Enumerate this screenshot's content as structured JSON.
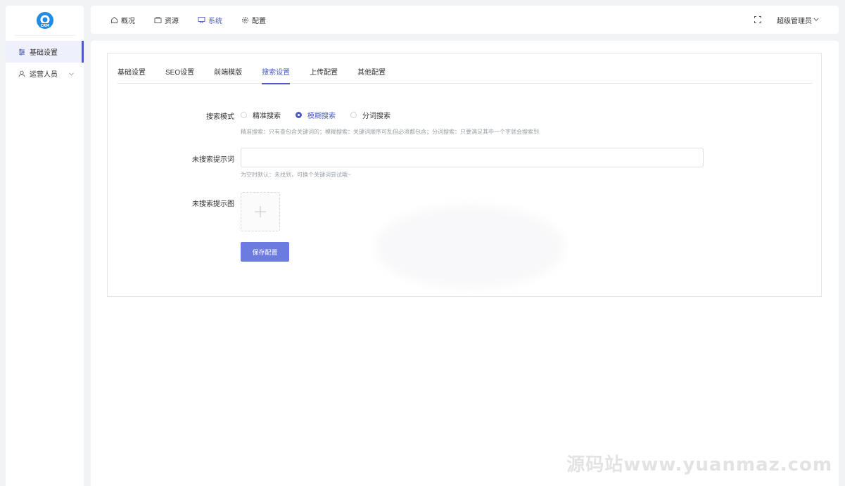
{
  "logo": {
    "text": "CRM"
  },
  "sidebar": {
    "items": [
      {
        "label": "基础设置",
        "icon": "sliders-icon"
      },
      {
        "label": "运营人员",
        "icon": "user-icon"
      }
    ]
  },
  "topnav": {
    "items": [
      {
        "label": "概况",
        "icon": "home-icon"
      },
      {
        "label": "资源",
        "icon": "folder-icon"
      },
      {
        "label": "系统",
        "icon": "monitor-icon"
      },
      {
        "label": "配置",
        "icon": "gear-icon"
      }
    ],
    "user": "超级管理员"
  },
  "tabs": [
    "基础设置",
    "SEO设置",
    "前端模版",
    "搜索设置",
    "上传配置",
    "其他配置"
  ],
  "form": {
    "search_mode_label": "搜索模式",
    "options": [
      "精准搜索",
      "模糊搜索",
      "分词搜索"
    ],
    "selected": "模糊搜索",
    "search_mode_help": "精准搜索：只有查包含关键词的；模糊搜索：关键词顺序可乱但必须都包含；分词搜索：只要满足其中一个字就会搜索到",
    "no_result_tip_label": "未搜索提示词",
    "no_result_tip_value": "",
    "no_result_tip_help": "为空时默认：未找到，可换个关键词尝试哦~",
    "no_result_image_label": "未搜索提示图",
    "save_label": "保存配置"
  },
  "watermark": "源码站www.yuanmaz.com",
  "colors": {
    "accent": "#4c5bc0",
    "button": "#6c7be0"
  }
}
